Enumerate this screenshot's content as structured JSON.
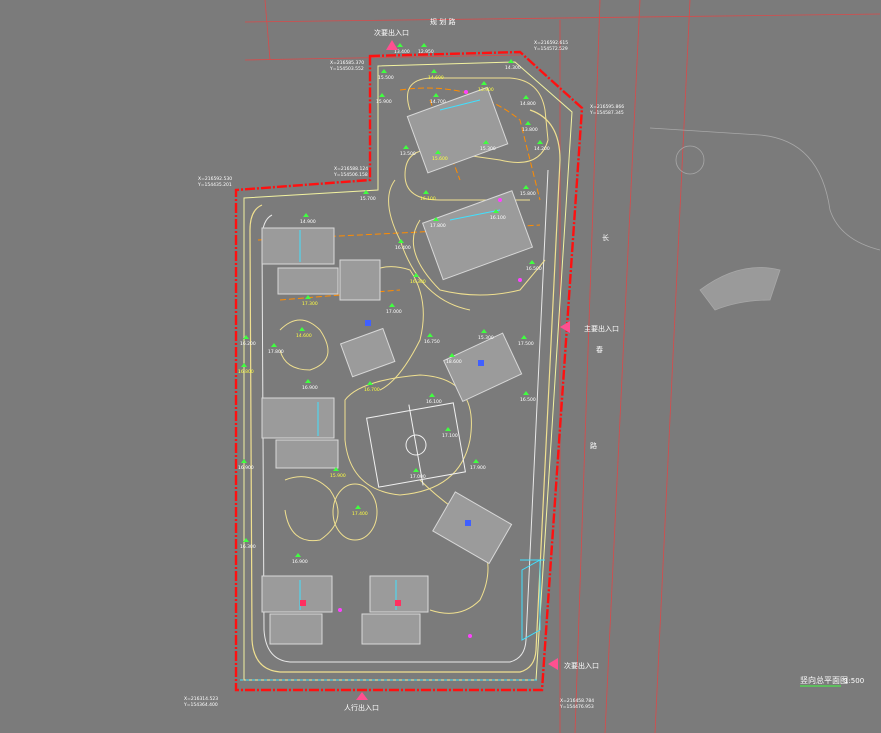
{
  "title": "竖向总平面图",
  "scale": "1:500",
  "road_north": "规 划 路",
  "road_east": [
    "长",
    "春",
    "路"
  ],
  "entrances": {
    "north": "次要出入口",
    "east_main": "主要出入口",
    "southeast": "次要出入口",
    "south": "人行出入口"
  },
  "coords": [
    {
      "x": "X=216592.615",
      "y": "Y=154572.529"
    },
    {
      "x": "X=216585.370",
      "y": "Y=154503.552"
    },
    {
      "x": "X=216595.866",
      "y": "Y=154587.345"
    },
    {
      "x": "X=216592.530",
      "y": "Y=154435.201"
    },
    {
      "x": "X=216588.124",
      "y": "Y=154506.158"
    },
    {
      "x": "X=216314.523",
      "y": "Y=154364.400"
    },
    {
      "x": "X=216458.784",
      "y": "Y=154476.953"
    }
  ],
  "elevations": [
    "13.400",
    "12.950",
    "15.500",
    "14.600",
    "14.300",
    "15.900",
    "14.700",
    "13.900",
    "14.800",
    "13.800",
    "13.500",
    "15.600",
    "15.300",
    "14.200",
    "15.700",
    "16.100",
    "15.800",
    "14.900",
    "16.400",
    "16.300",
    "17.800",
    "16.100",
    "16.500",
    "17.300",
    "17.000",
    "16.200",
    "17.800",
    "14.600",
    "16.750",
    "15.300",
    "17.500",
    "16.800",
    "16.100",
    "18.600",
    "16.900",
    "16.700",
    "17.100",
    "16.500",
    "16.900",
    "15.900",
    "17.900",
    "16.300",
    "16.900",
    "17.400",
    "17.000"
  ],
  "colors": {
    "background": "#7b7b7b",
    "boundary": "#ff1010",
    "road": "#f0e090",
    "road_inner": "#e8e8e8",
    "building": "#c8c8c8",
    "contour_orange": "#ff8c00",
    "accent_green": "#40ff40",
    "accent_cyan": "#40e0ff",
    "accent_magenta": "#ff40ff",
    "text_white": "#ffffff",
    "text_yellow": "#ffff40"
  }
}
